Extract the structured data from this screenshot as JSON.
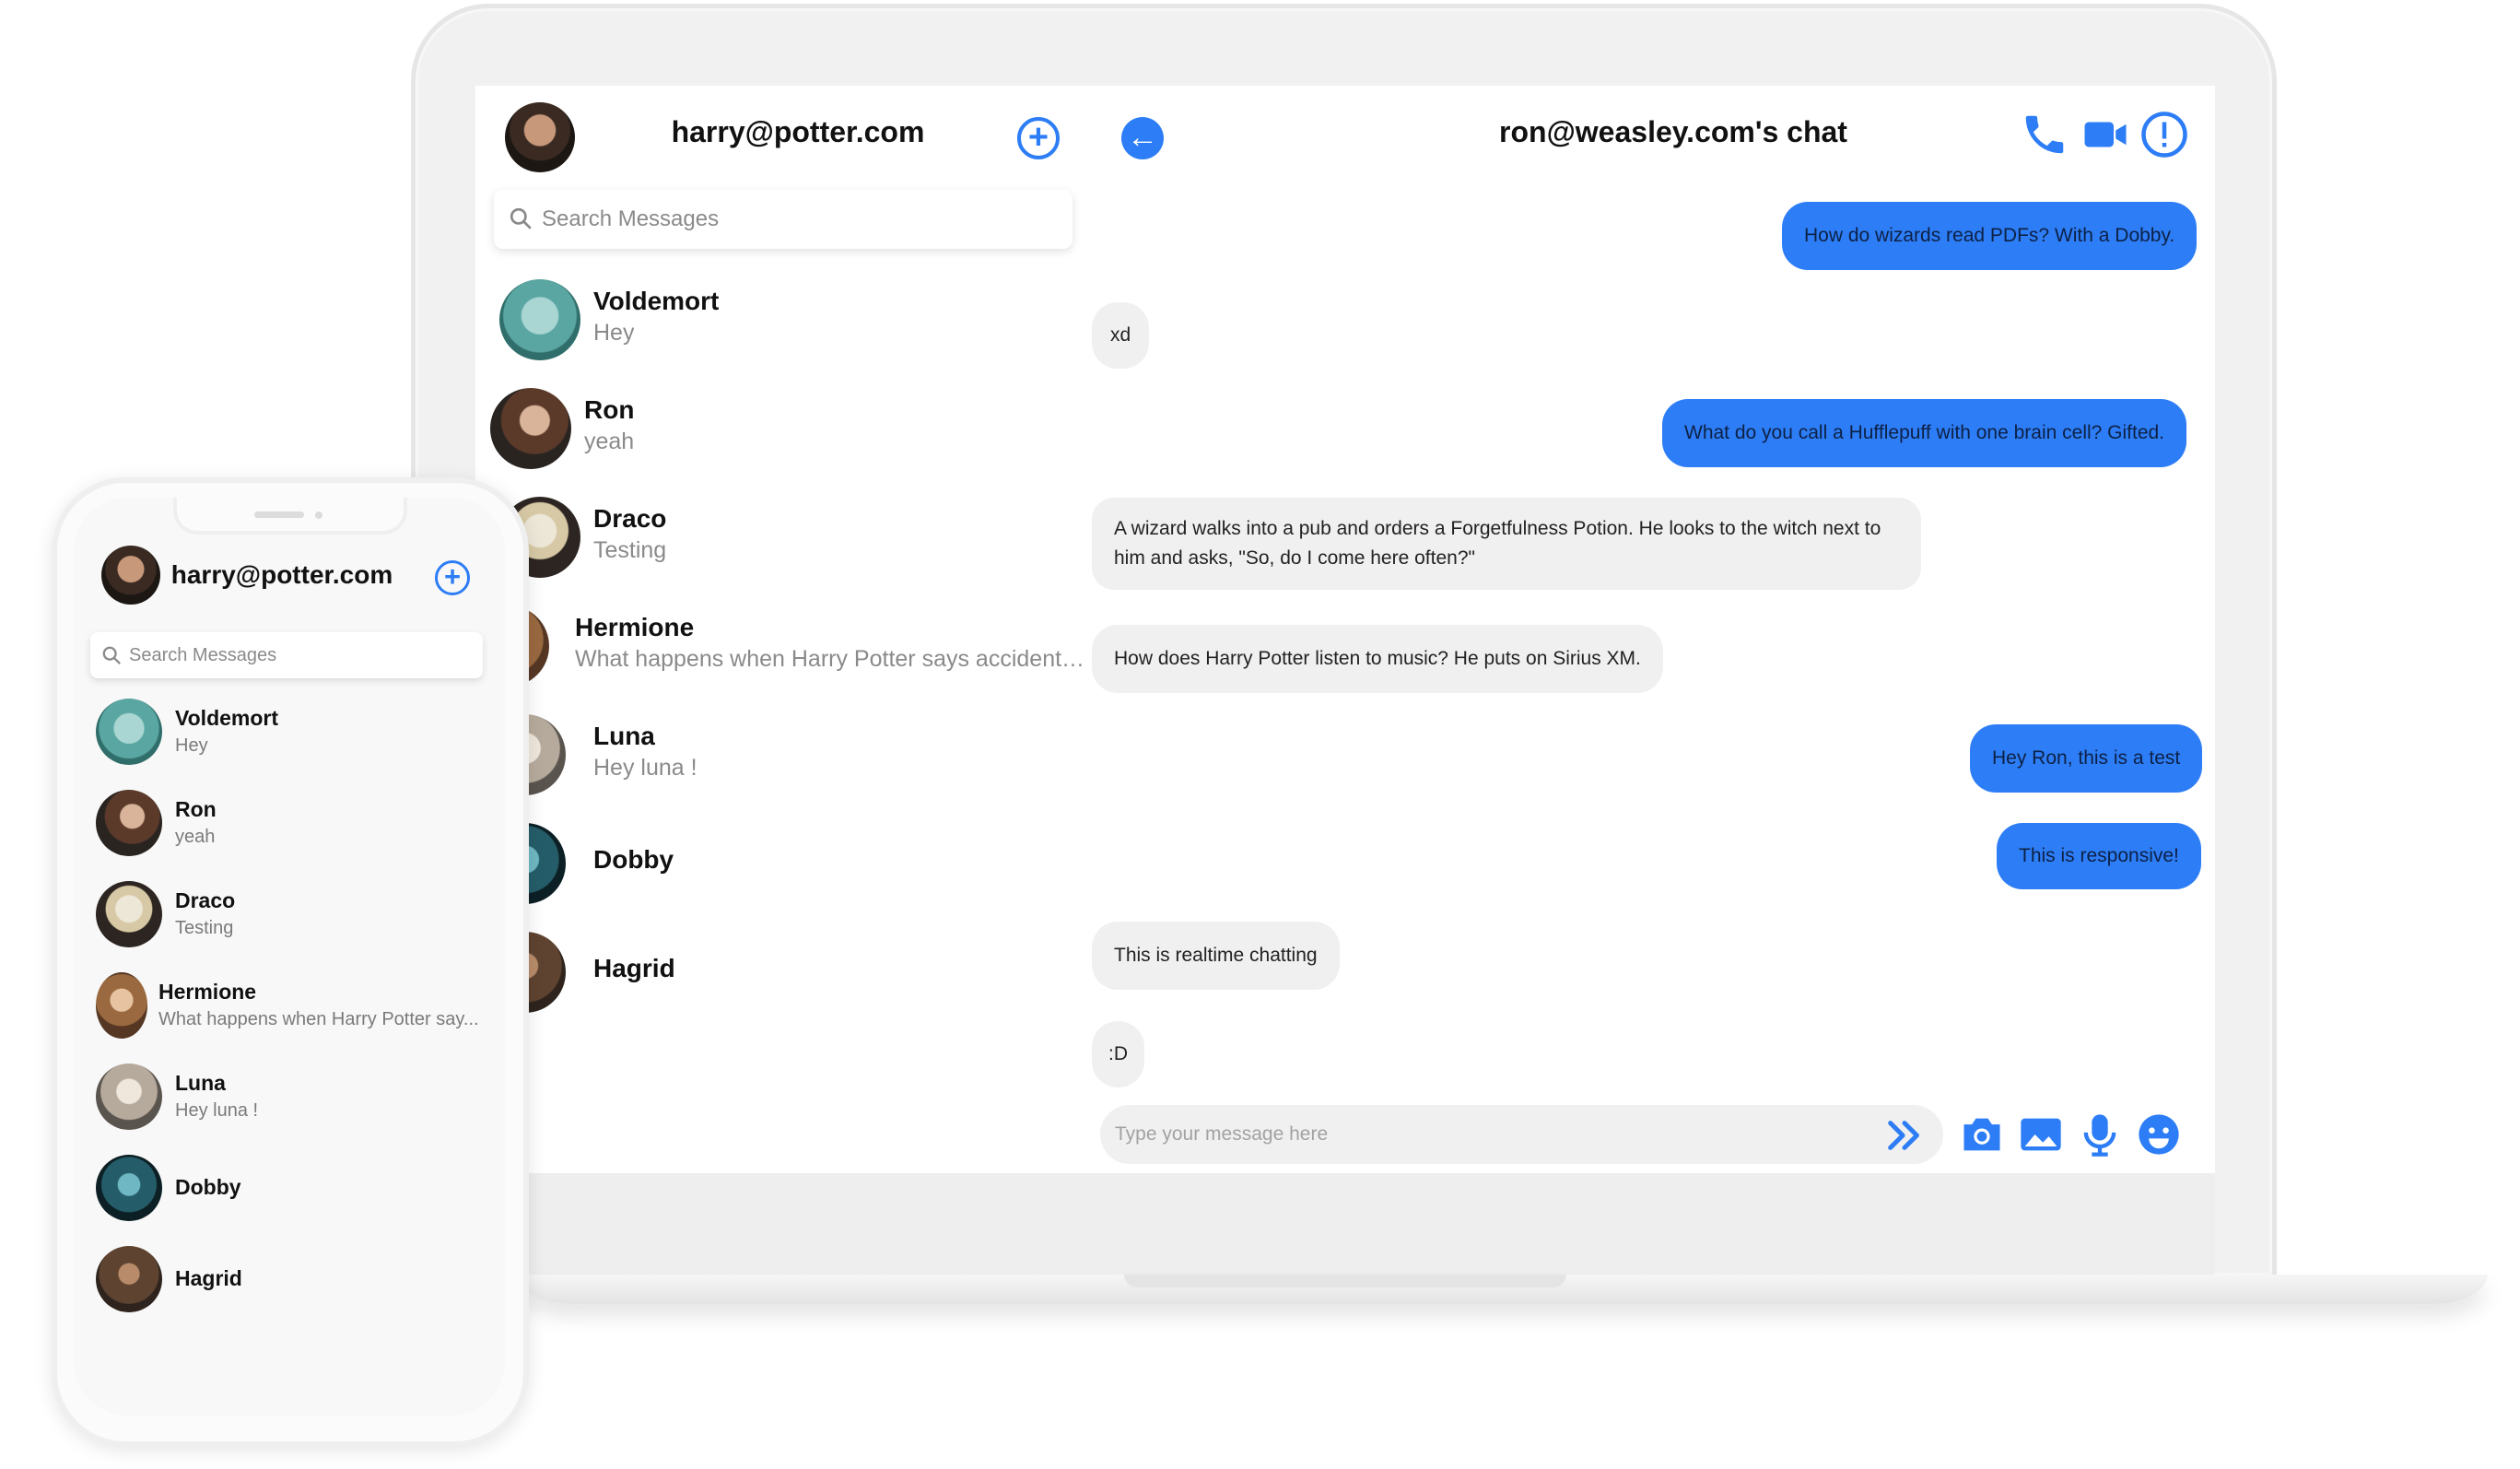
{
  "laptop": {
    "sidebar": {
      "current_user": "harry@potter.com",
      "search_placeholder": "Search Messages",
      "contacts": [
        {
          "name": "Voldemort",
          "last_message": "Hey"
        },
        {
          "name": "Ron",
          "last_message": "yeah"
        },
        {
          "name": "Draco",
          "last_message": "Testing"
        },
        {
          "name": "Hermione",
          "last_message": "What happens when Harry Potter says accidental..."
        },
        {
          "name": "Luna",
          "last_message": "Hey luna !"
        },
        {
          "name": "Dobby",
          "last_message": ""
        },
        {
          "name": "Hagrid",
          "last_message": ""
        }
      ]
    },
    "chat": {
      "title": "ron@weasley.com's chat",
      "messages": [
        {
          "direction": "out",
          "text": "How do wizards read PDFs? With a Dobby."
        },
        {
          "direction": "in",
          "text": "xd"
        },
        {
          "direction": "out",
          "text": "What do you call a Hufflepuff with one brain cell? Gifted."
        },
        {
          "direction": "in",
          "text": "A wizard walks into a pub and orders a Forgetfulness Potion. He looks to the witch next to him and asks, \"So, do I come here often?\""
        },
        {
          "direction": "in",
          "text": "How does Harry Potter listen to music? He puts on Sirius XM."
        },
        {
          "direction": "out",
          "text": "Hey Ron, this is a test"
        },
        {
          "direction": "out",
          "text": "This is responsive!"
        },
        {
          "direction": "in",
          "text": "This is realtime chatting"
        },
        {
          "direction": "in",
          "text": ":D"
        }
      ],
      "composer_placeholder": "Type your message here"
    }
  },
  "phone": {
    "current_user": "harry@potter.com",
    "search_placeholder": "Search Messages",
    "contacts": [
      {
        "name": "Voldemort",
        "last_message": "Hey"
      },
      {
        "name": "Ron",
        "last_message": "yeah"
      },
      {
        "name": "Draco",
        "last_message": "Testing"
      },
      {
        "name": "Hermione",
        "last_message": "What happens when Harry Potter say..."
      },
      {
        "name": "Luna",
        "last_message": "Hey luna !"
      },
      {
        "name": "Dobby",
        "last_message": ""
      },
      {
        "name": "Hagrid",
        "last_message": ""
      }
    ]
  },
  "colors": {
    "accent": "#2d7df6",
    "incoming_bubble": "#f0f0f0"
  },
  "icons": [
    "search-icon",
    "add-chat-icon",
    "back-arrow-icon",
    "phone-call-icon",
    "video-call-icon",
    "info-icon",
    "send-icon",
    "camera-icon",
    "image-icon",
    "microphone-icon",
    "emoji-icon"
  ]
}
